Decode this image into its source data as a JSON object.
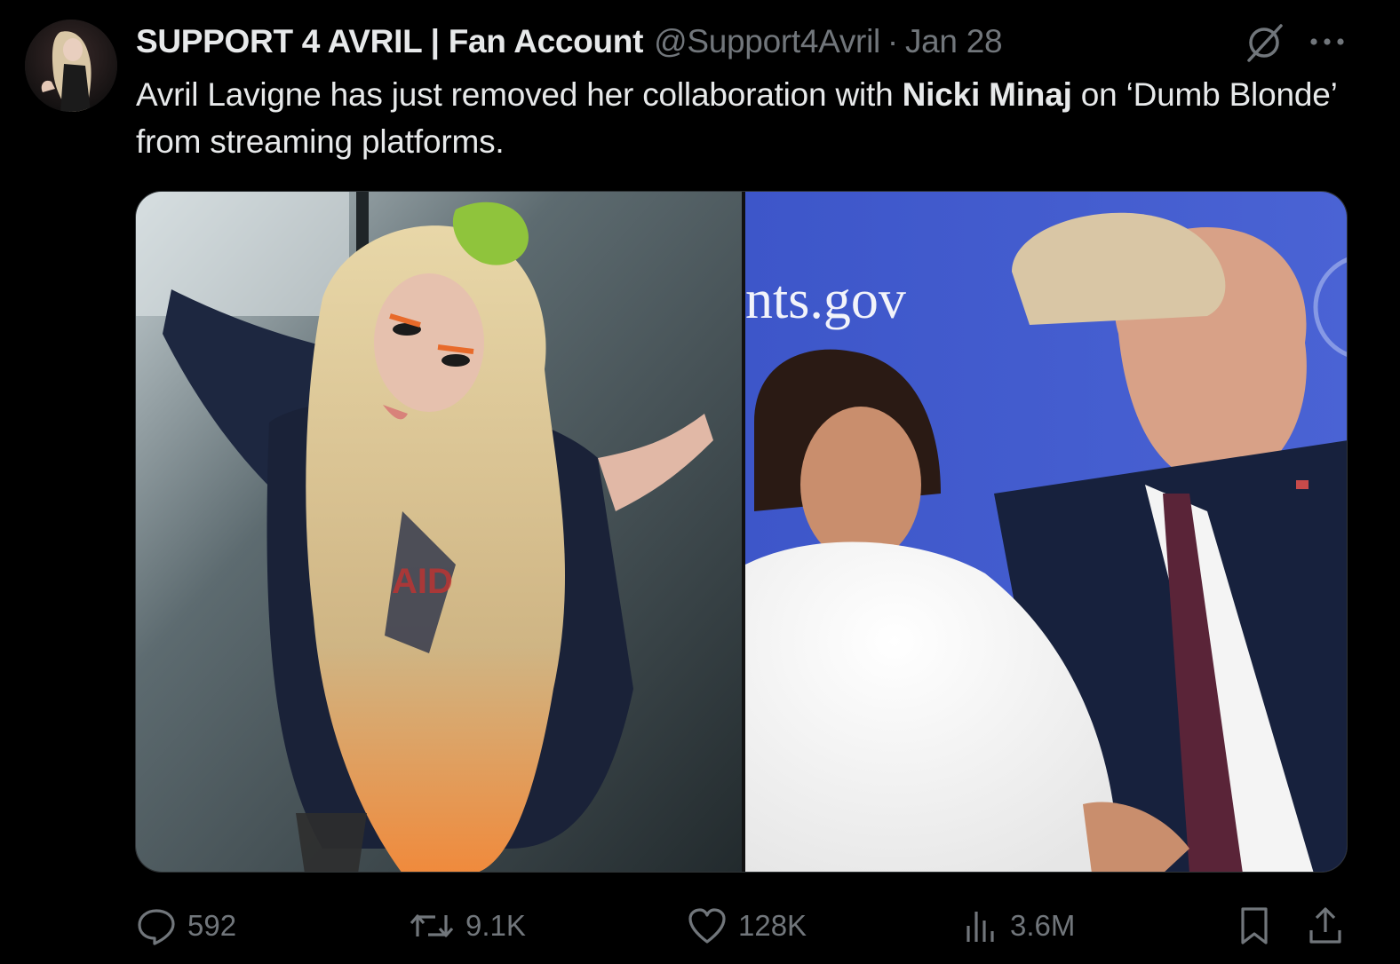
{
  "tweet": {
    "author": {
      "display_name": "SUPPORT 4 AVRIL | Fan Account",
      "handle": "@Support4Avril",
      "avatar_icon": "profile-photo"
    },
    "separator": "·",
    "date": "Jan 28",
    "text": {
      "part1": "Avril Lavigne has just removed her collaboration with ",
      "bold": "Nicki Minaj",
      "part2": " on ‘Dumb Blonde’ from streaming platforms."
    },
    "media": {
      "image_count": 2,
      "right_sign_text": "nts.gov"
    },
    "actions": {
      "replies": "592",
      "reposts": "9.1K",
      "likes": "128K",
      "views": "3.6M"
    }
  },
  "colors": {
    "background": "#000000",
    "text_primary": "#e7e9ea",
    "text_secondary": "#71767b",
    "border": "#2f3336"
  },
  "icons": [
    "grok-icon",
    "more-icon",
    "reply-icon",
    "retweet-icon",
    "like-icon",
    "views-icon",
    "bookmark-icon",
    "share-icon"
  ]
}
